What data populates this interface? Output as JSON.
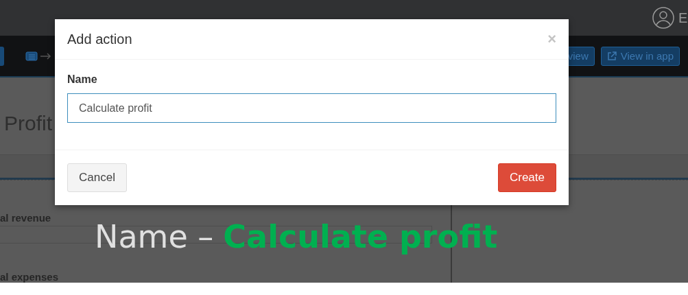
{
  "topbar": {
    "user_initial": "E"
  },
  "toolbar": {
    "buttons": [
      {
        "label": "view",
        "kind": "plain"
      },
      {
        "label": "View in app",
        "kind": "external"
      }
    ]
  },
  "page": {
    "title": "Profit",
    "fields": [
      {
        "label": "al revenue",
        "kind": "input"
      },
      {
        "label": "al expenses",
        "kind": "label"
      }
    ]
  },
  "dialog": {
    "title": "Add action",
    "close": "×",
    "field_label": "Name",
    "value": "Calculate profit",
    "buttons": [
      {
        "label": "Cancel",
        "kind": "default"
      },
      {
        "label": "Create",
        "kind": "primary"
      }
    ]
  },
  "caption": {
    "label": "Name –",
    "value": "Calculate profit"
  }
}
